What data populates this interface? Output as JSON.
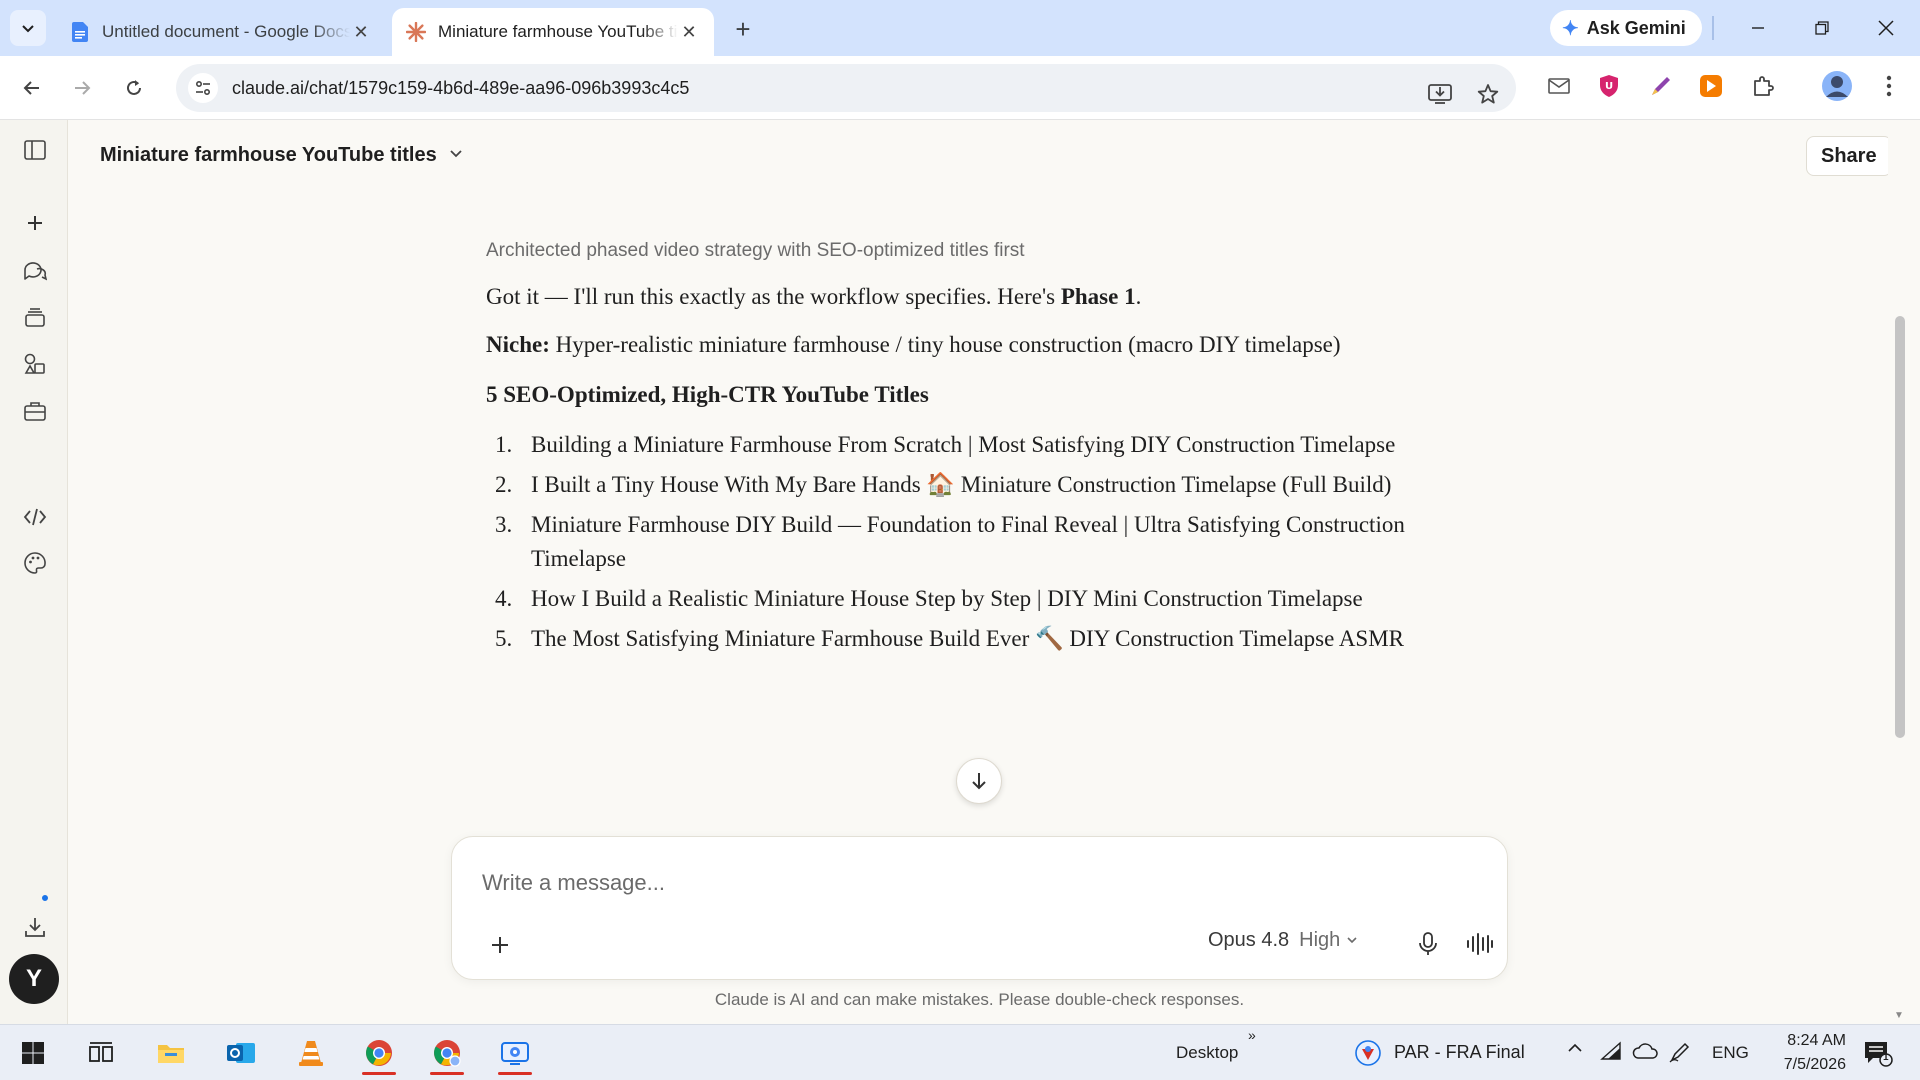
{
  "browser": {
    "tabs": [
      {
        "title": "Untitled document - Google Docs",
        "active": false
      },
      {
        "title": "Miniature farmhouse YouTube titles",
        "active": true
      }
    ],
    "ask_gemini": "Ask Gemini",
    "url": "claude.ai/chat/1579c159-4b6d-489e-aa96-096b3993c4c5"
  },
  "app": {
    "chat_title": "Miniature farmhouse YouTube titles",
    "share_label": "Share",
    "avatar_initial": "Y"
  },
  "message": {
    "thinking_summary": "Architected phased video strategy with SEO-optimized titles first",
    "intro_text": "Got it — I'll run this exactly as the workflow specifies. Here's ",
    "intro_bold": "Phase 1",
    "intro_end": ".",
    "niche_label": "Niche:",
    "niche_text": " Hyper-realistic miniature farmhouse / tiny house construction (macro DIY timelapse)",
    "titles_heading": "5 SEO-Optimized, High-CTR YouTube Titles",
    "titles": [
      {
        "num": "1.",
        "text": "Building a Miniature Farmhouse From Scratch | Most Satisfying DIY Construction Timelapse"
      },
      {
        "num": "2.",
        "text": "I Built a Tiny House With My Bare Hands 🏠 Miniature Construction Timelapse (Full Build)"
      },
      {
        "num": "3.",
        "text": "Miniature Farmhouse DIY Build — Foundation to Final Reveal | Ultra Satisfying Construction Timelapse"
      },
      {
        "num": "4.",
        "text": "How I Build a Realistic Miniature House Step by Step | DIY Mini Construction Timelapse"
      },
      {
        "num": "5.",
        "text": "The Most Satisfying Miniature Farmhouse Build Ever 🔨 DIY Construction Timelapse ASMR"
      }
    ]
  },
  "composer": {
    "placeholder": "Write a message...",
    "model": "Opus 4.8",
    "effort": "High"
  },
  "disclaimer": "Claude is AI and can make mistakes. Please double-check responses.",
  "taskbar": {
    "desktop_label": "Desktop",
    "overflow_label": "»",
    "news_label": "PAR - FRA Final",
    "language": "ENG",
    "time": "8:24 AM",
    "date": "7/5/2026",
    "notification_count": "1"
  },
  "colors": {
    "tabstrip": "#d3e3fd",
    "claude_bg": "#faf9f5",
    "claude_accent": "#d97757",
    "docs_blue": "#4285f4",
    "recording_red": "#d93025"
  }
}
